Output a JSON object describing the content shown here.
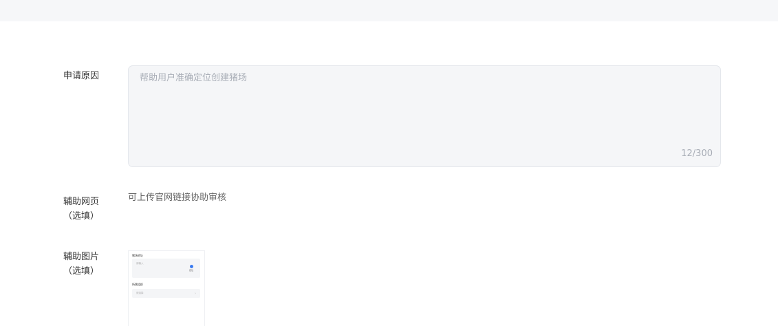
{
  "form": {
    "reason": {
      "label": "申请原因",
      "value": "帮助用户准确定位创建猪场",
      "counter": "12/300"
    },
    "website": {
      "label": "辅助网页",
      "optional": "（选填）",
      "hint": "可上传官网链接协助审核"
    },
    "image": {
      "label": "辅助图片",
      "optional": "（选填）",
      "thumbnail": {
        "address_label": "猪场地址",
        "address_placeholder": "请输入",
        "locate_label": "定位",
        "org_label": "所属组织",
        "org_placeholder": "请选择"
      }
    }
  },
  "colors": {
    "top_bar": "#f6f7f9",
    "textarea_bg": "#f5f6f8",
    "placeholder": "#a8adb6",
    "accent": "#3a7bf0"
  }
}
